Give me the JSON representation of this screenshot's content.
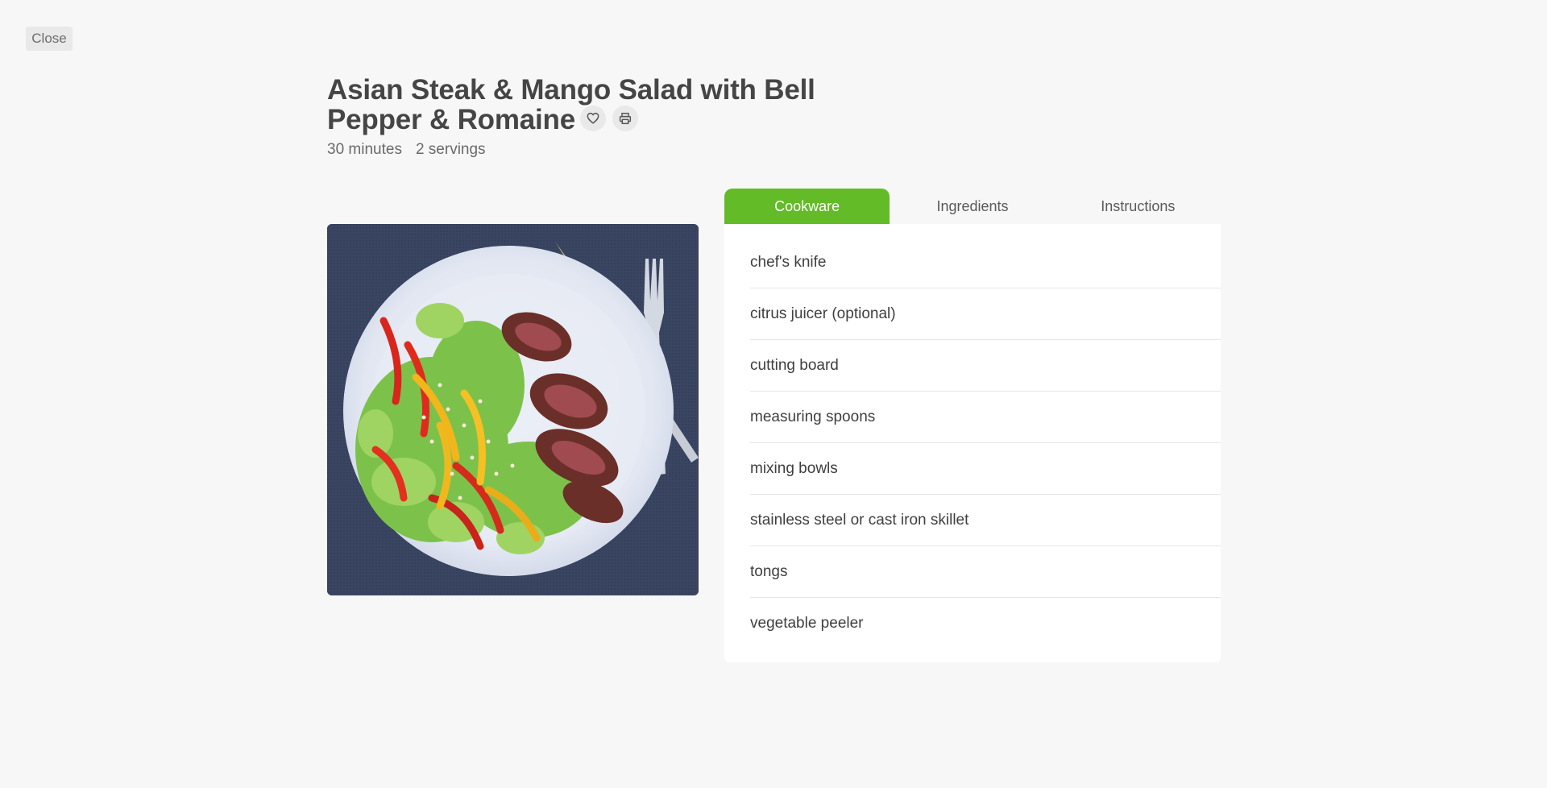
{
  "close_label": "Close",
  "recipe": {
    "title": "Asian Steak & Mango Salad with Bell Pepper & Romaine",
    "time": "30 minutes",
    "servings": "2 servings"
  },
  "actions": {
    "favorite_icon": "heart-icon",
    "print_icon": "printer-icon"
  },
  "tabs": [
    {
      "label": "Cookware",
      "active": true
    },
    {
      "label": "Ingredients",
      "active": false
    },
    {
      "label": "Instructions",
      "active": false
    }
  ],
  "cookware": [
    "chef's knife",
    "citrus juicer (optional)",
    "cutting board",
    "measuring spoons",
    "mixing bowls",
    "stainless steel or cast iron skillet",
    "tongs",
    "vegetable peeler"
  ],
  "colors": {
    "accent": "#62bb27",
    "background": "#f7f7f7",
    "text": "#454545"
  }
}
